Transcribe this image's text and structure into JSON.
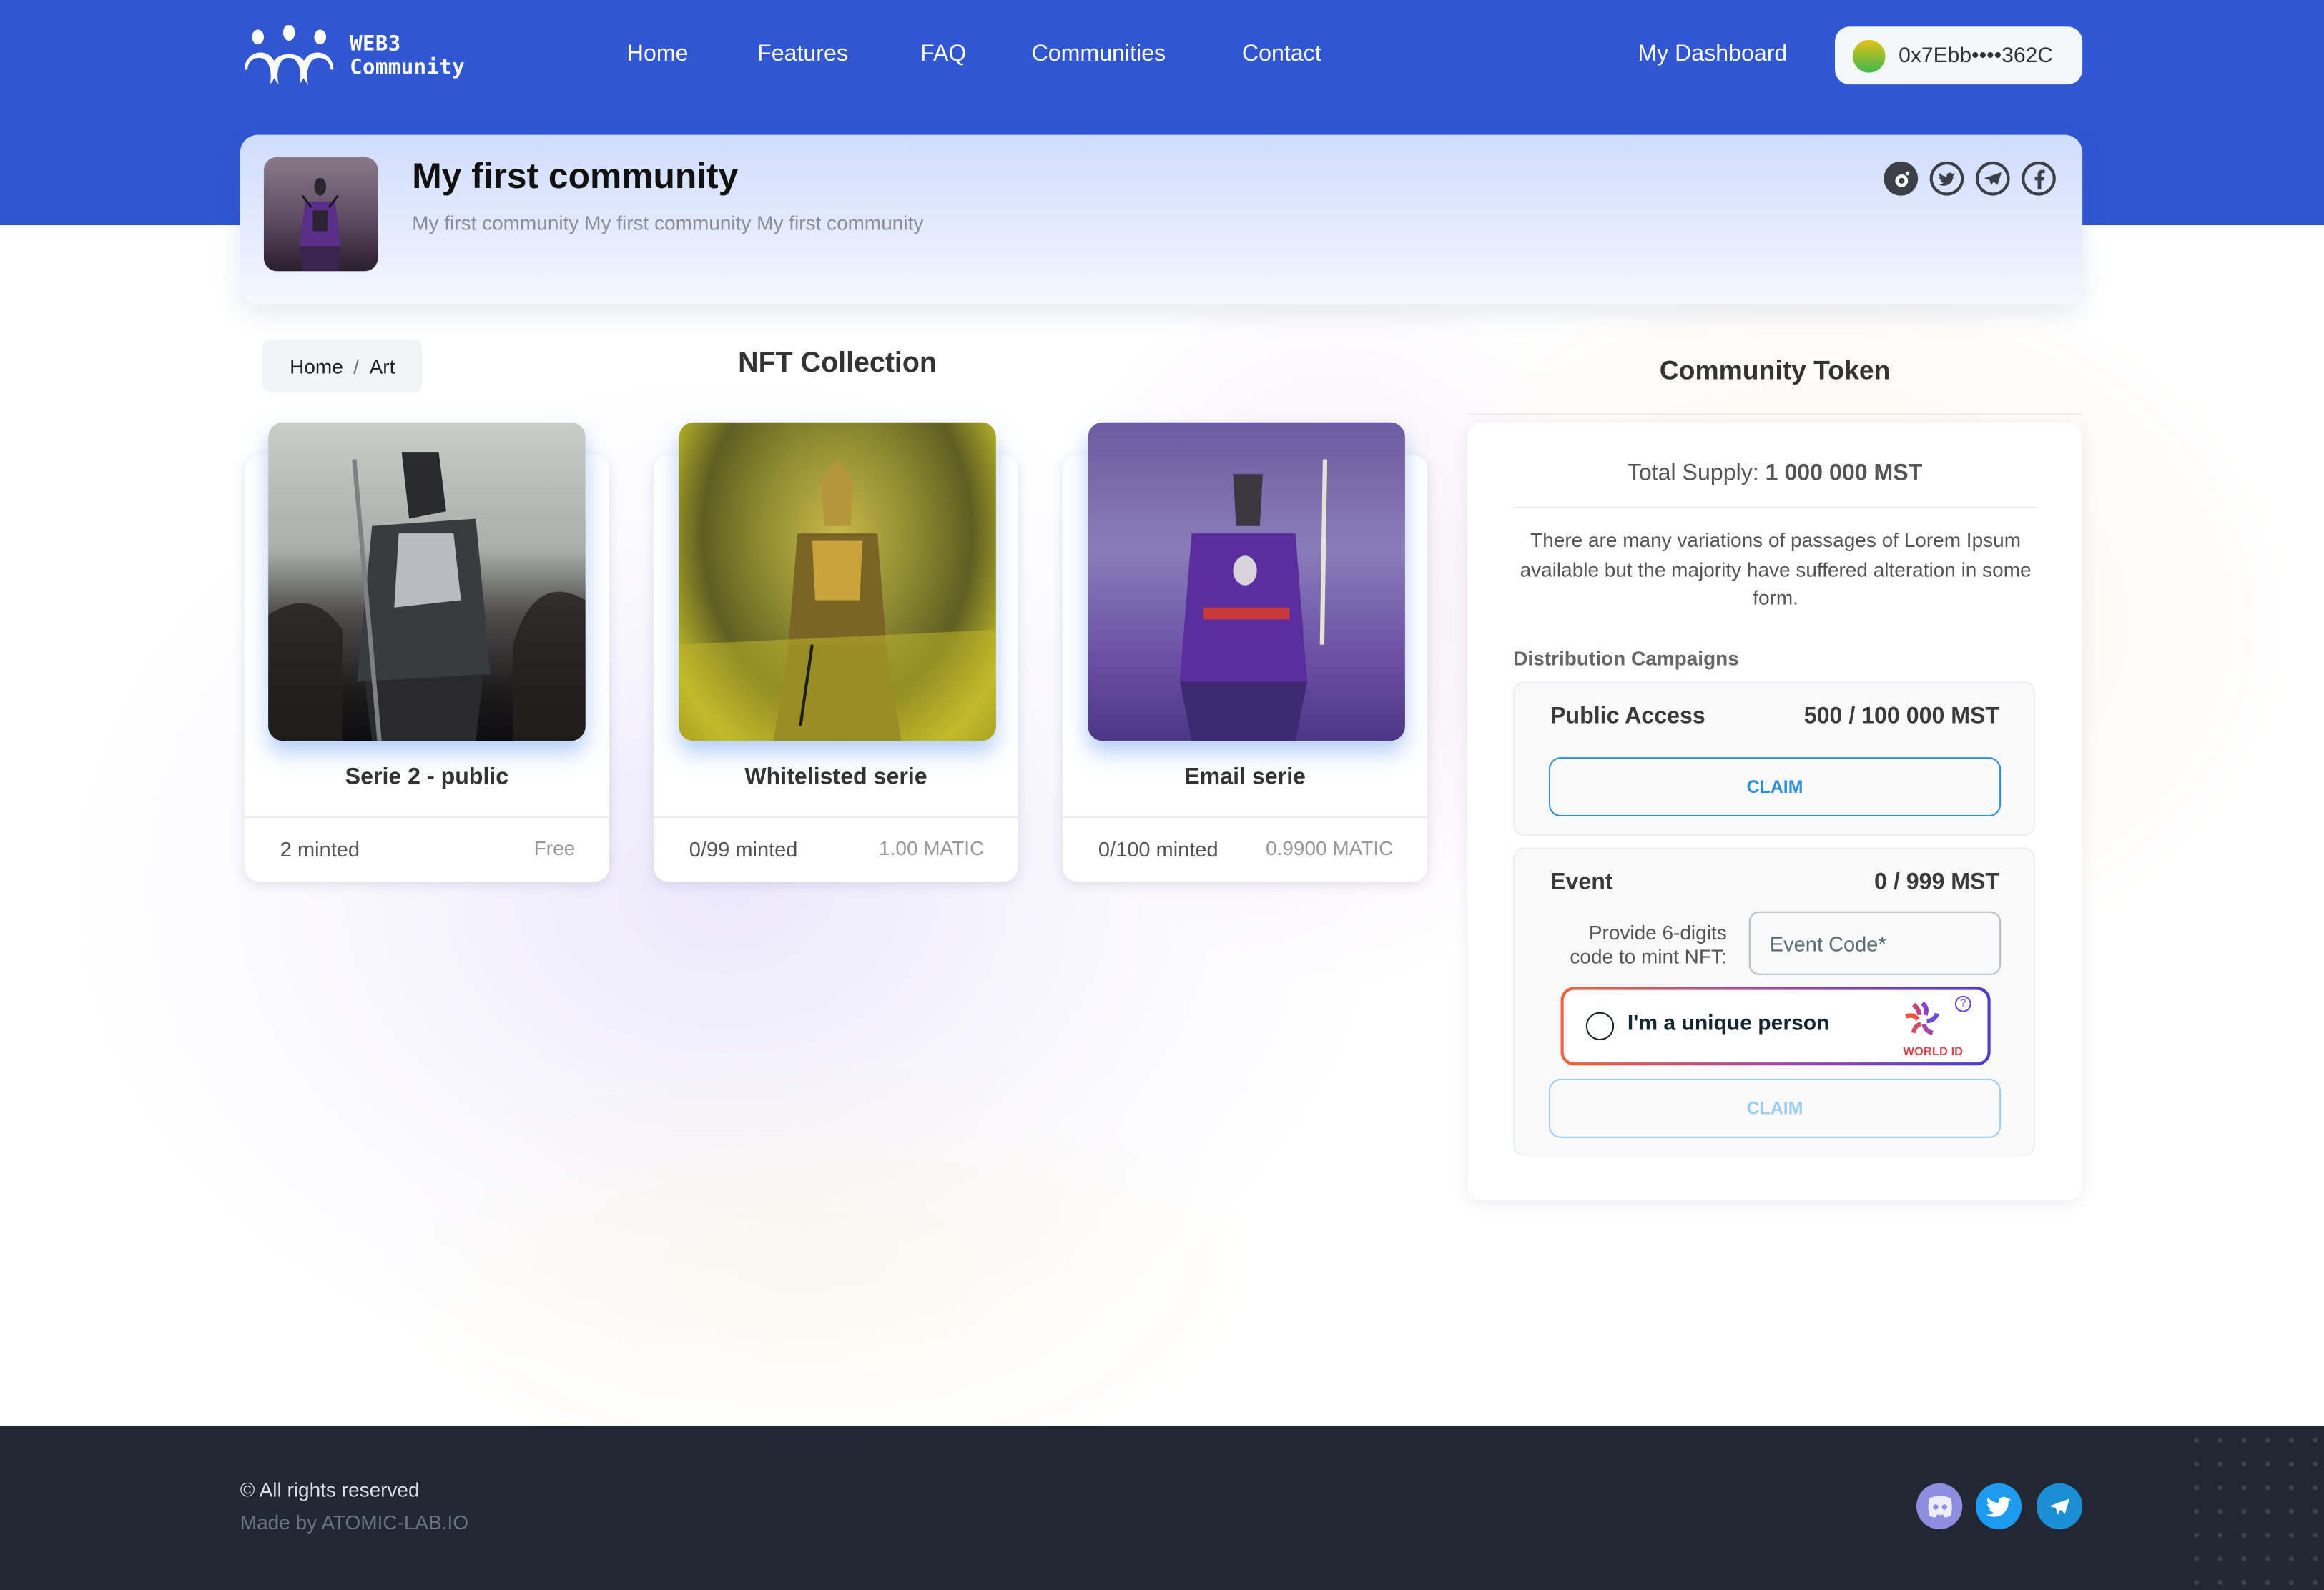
{
  "brand": {
    "line1": "WEB3",
    "line2": "Community"
  },
  "nav": {
    "items": [
      {
        "label": "Home"
      },
      {
        "label": "Features"
      },
      {
        "label": "FAQ"
      },
      {
        "label": "Communities"
      },
      {
        "label": "Contact"
      }
    ],
    "dashboard_label": "My Dashboard",
    "wallet_address": "0x7Ebb••••362C"
  },
  "community": {
    "title": "My first community",
    "description": "My first community My first community My first community",
    "social_icons": [
      "reddit-icon",
      "twitter-icon",
      "telegram-icon",
      "facebook-icon"
    ]
  },
  "breadcrumb": {
    "items": [
      "Home",
      "Art"
    ],
    "separator": "/"
  },
  "nft_collection": {
    "title": "NFT Collection",
    "cards": [
      {
        "name": "Serie 2 - public",
        "minted": "2 minted",
        "price": "Free",
        "theme": "dark-silver"
      },
      {
        "name": "Whitelisted serie",
        "minted": "0/99 minted",
        "price": "1.00 MATIC",
        "theme": "gold-yellow"
      },
      {
        "name": "Email serie",
        "minted": "0/100 minted",
        "price": "0.9900 MATIC",
        "theme": "purple"
      }
    ]
  },
  "token": {
    "title": "Community Token",
    "supply_label": "Total Supply:",
    "supply_value": "1 000 000 MST",
    "description": "There are many variations of passages of Lorem Ipsum available but the majority have suffered alteration in some form.",
    "distribution_label": "Distribution Campaigns",
    "campaigns": [
      {
        "name": "Public Access",
        "amount": "500 / 100 000 MST",
        "claim_label": "CLAIM",
        "enabled": true
      },
      {
        "name": "Event",
        "amount": "0 / 999 MST",
        "code_prompt": "Provide 6-digits code to mint NFT:",
        "code_placeholder": "Event Code*",
        "code_value": "",
        "world_id_label": "I'm a unique person",
        "world_id_brand": "WORLD ID",
        "claim_label": "CLAIM",
        "enabled": false
      }
    ]
  },
  "footer": {
    "copyright": "© All rights reserved",
    "made_by": "Made by ATOMIC-LAB.IO",
    "social_icons": [
      "discord-icon",
      "twitter-icon",
      "telegram-icon"
    ]
  },
  "colors": {
    "primary": "#3056d3",
    "claim_blue": "#2d8fe0",
    "footer_bg": "#212833",
    "discord": "#8e8ee0",
    "twitter": "#1d9bf0",
    "telegram": "#1a8fd6"
  }
}
